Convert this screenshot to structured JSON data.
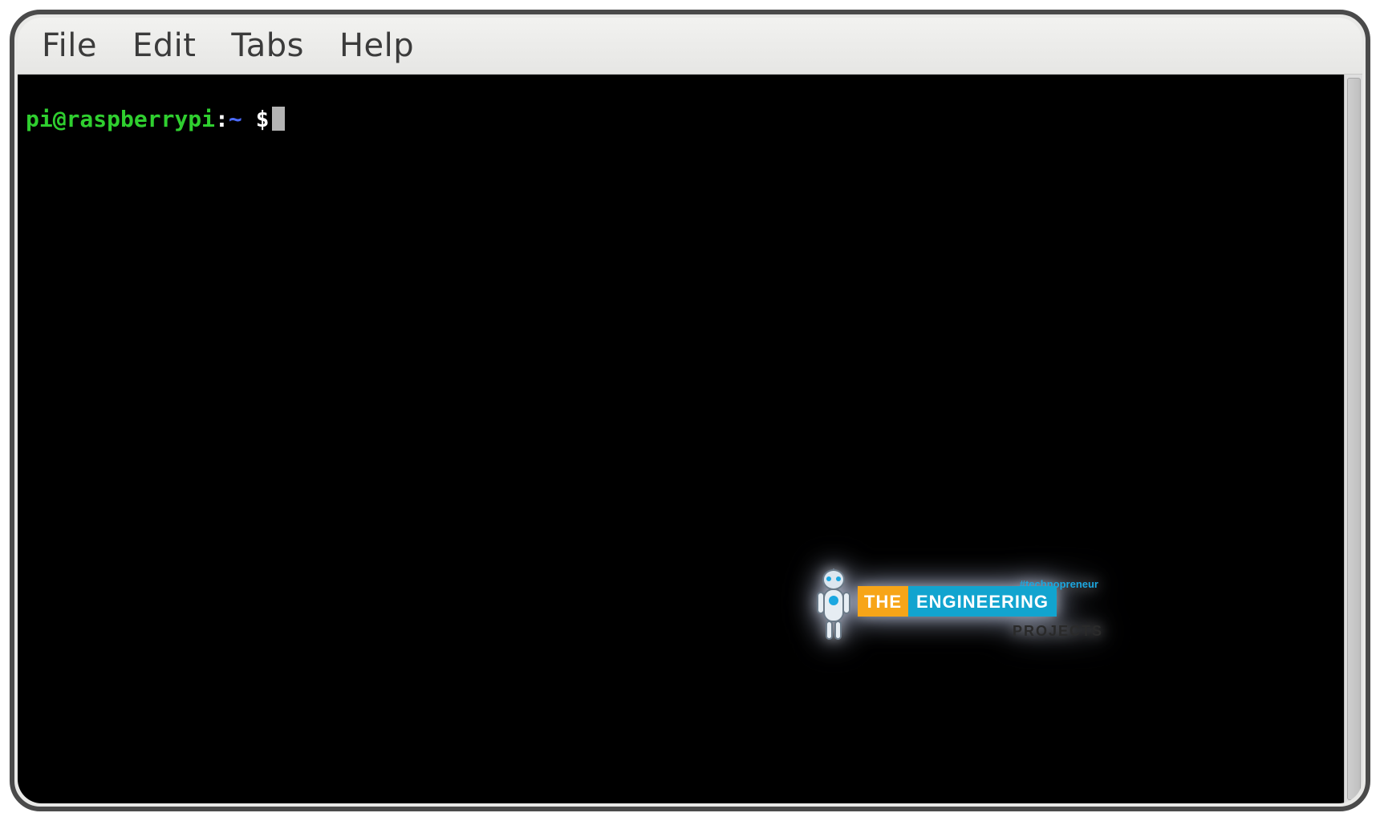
{
  "menubar": {
    "items": [
      "File",
      "Edit",
      "Tabs",
      "Help"
    ]
  },
  "terminal": {
    "prompt": {
      "user": "pi",
      "at": "@",
      "host": "raspberrypi",
      "colon": ":",
      "path": "~",
      "space": " ",
      "dollar": "$"
    },
    "command": ""
  },
  "watermark": {
    "tag": "#technopreneur",
    "the": "THE",
    "engineering": "ENGINEERING",
    "projects": "PROJECTS"
  }
}
